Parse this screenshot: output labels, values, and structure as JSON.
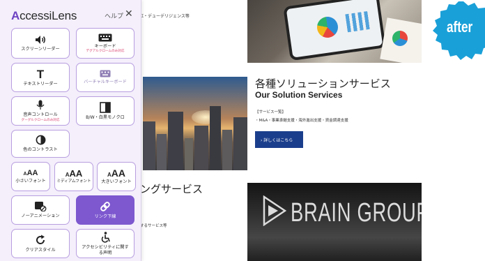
{
  "panel": {
    "brand_first": "A",
    "brand_rest": "ccessiLens",
    "help_label": "ヘルプ",
    "close_symbol": "✕",
    "accent_color": "#7d58cf",
    "buttons": {
      "screen_reader": {
        "label": "スクリーンリーダー",
        "icon": "speaker-icon"
      },
      "keyboard": {
        "label": "キーボード",
        "note": "デグアルクロームのみ対応",
        "icon": "keyboard-icon"
      },
      "text_reader": {
        "label": "テキストリーダー",
        "icon": "text-t-icon"
      },
      "virtual_keyboard": {
        "label": "バーチャルキーボード",
        "icon": "virtual-keyboard-icon"
      },
      "voice_control": {
        "label": "音声コントロール",
        "note": "グーグルクロームのみ対応",
        "icon": "microphone-icon"
      },
      "bw_mono": {
        "label": "B/W・白黒モノクロ",
        "icon": "half-square-icon"
      },
      "color_contrast": {
        "label": "色のコントラスト",
        "icon": "contrast-icon"
      },
      "small_font": {
        "label": "小さいフォント",
        "glyph": "AA",
        "prefix": "A"
      },
      "medium_font": {
        "label": "ミディアムフォント",
        "glyph": "AA",
        "prefix": "A"
      },
      "large_font": {
        "label": "大きいフォント",
        "glyph": "AA",
        "prefix": "A"
      },
      "no_animation": {
        "label": "ノーアニメーション",
        "icon": "stop-animation-icon"
      },
      "link_underline": {
        "label": "リンク下線",
        "icon": "link-icon"
      },
      "clear_style": {
        "label": "クリアスタイル",
        "icon": "refresh-icon"
      },
      "accessibility_statement": {
        "label": "アクセシビリティに関する声明",
        "icon": "accessibility-person-icon"
      }
    }
  },
  "site": {
    "top_cut_text": "ｴ・デューデリジェンス等",
    "solution_title": "各種ソリューションサービス",
    "solution_subtitle": "Our Solution Services",
    "solution_list_heading": "【サービス一覧】",
    "solution_list": "・M&A・事業承継支援・海外進出支援・資金調達支援",
    "solution_button": "›  詳しくはこちら",
    "consulting_title_partial": "ングサービス",
    "consulting_text_partial": "するサービス等",
    "brain_sign": "BRAIN GROUPS",
    "after_label": "after",
    "after_color": "#1aa0d8"
  }
}
